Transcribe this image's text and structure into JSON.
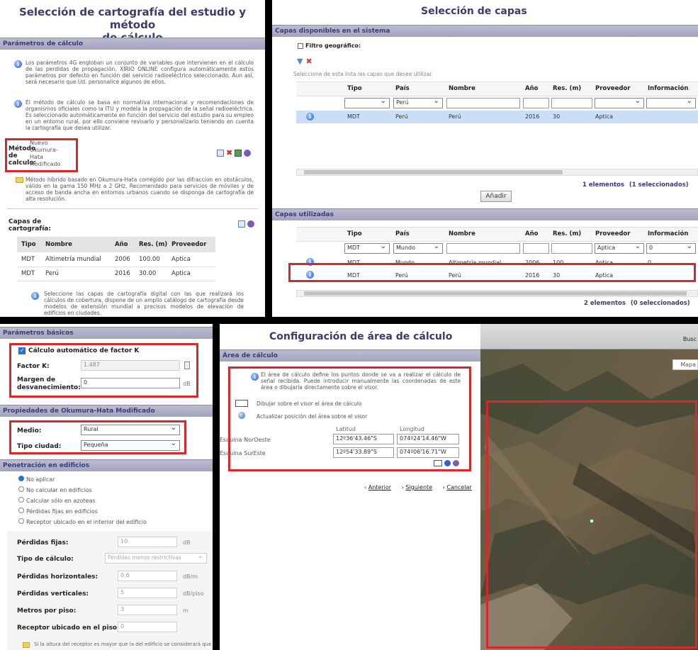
{
  "p1": {
    "title_l1": "Selección de cartografía del estudio y método",
    "title_l2": "de cálculo",
    "section": "Parámetros de cálculo",
    "info1": "Los parámetros 4G engloban un conjunto de variables que intervienen en el cálculo de las perdidas de propagación. XIRIO ONLINE configura automáticamente estos parámetros por defecto en función del servicio radioeléctrico seleccionado. Aun así, será necesario que Ud. personalice algunos de ellos.",
    "info2": "El método de cálculo se basa en normativa internacional y recomendaciones de organismos oficiales como la ITU y modela la propagación de la señal radioeléctrica. Es seleccionado automáticamente en función del servicio del estudio para su empleo en un entorno rural, por ello conviene revisarlo y personalizarlo teniendo en cuenta la cartografía que desea utilizar.",
    "metodo_l1": "Método",
    "metodo_l2": "de",
    "metodo_l3": "calculo:",
    "metodo_v1": "Nuevo",
    "metodo_v2": "Okumura-",
    "metodo_v3": "Hata",
    "metodo_v4": "Modificado",
    "desc": "Método híbrido basado en Okumura-Hata corregido por las difraccion en obstáculos, válido en la gama 150 MHz a 2 GHz. Recomendado para servicios de móviles y de acceso de banda ancha en entornos urbanos cuando se disponga de cartografía de alta resolución.",
    "capas_l1": "Capas de",
    "capas_l2": "cartografía:",
    "cols": [
      "Tipo",
      "Nombre",
      "Año",
      "Res. (m)",
      "Proveedor"
    ],
    "rows": [
      [
        "MDT",
        "Altimetría mundial",
        "2006",
        "100.00",
        "Aptica"
      ],
      [
        "MDT",
        "Perú",
        "2016",
        "30.00",
        "Aptica"
      ]
    ],
    "info3": "Seleccione las capas de cartografía digital con las que realizará los cálculos de cobertura, dispone de un amplio catálogo de cartografía desde modelos de extensión mundial a precisos modelos de elevación de edificios en ciudades."
  },
  "p2": {
    "title": "Selección de capas",
    "section1": "Capas disponibles en el sistema",
    "filtro": "Filtro geográfico:",
    "hint": "Seleccione de esta lista las capas que desee utilizar.",
    "cols": [
      "Tipo",
      "País",
      "Nombre",
      "Año",
      "Res. (m)",
      "Proveedor",
      "Información"
    ],
    "filter1_pais": "Perú",
    "row1": [
      "MDT",
      "Perú",
      "Perú",
      "2016",
      "30",
      "Aptica",
      ""
    ],
    "count1": "1 elementos",
    "sel1": "(1 seleccionados)",
    "add": "Añadir",
    "section2": "Capas utilizadas",
    "filter2_tipo": "MDT",
    "filter2_pais": "Mundo",
    "filter2_prov": "Aptica",
    "filter2_info": "0",
    "rows2": [
      [
        "MDT",
        "Mundo",
        "Altimetría mundial",
        "2006",
        "100",
        "Aptica",
        "0"
      ],
      [
        "MDT",
        "Perú",
        "Perú",
        "2016",
        "30",
        "Aptica",
        ""
      ]
    ],
    "count2": "2 elementos",
    "sel2": "(0 seleccionados)"
  },
  "p3": {
    "section1": "Parámetros básicos",
    "auto_k": "Cálculo automático de factor K",
    "factor_k_label": "Factor K:",
    "factor_k": "1.487",
    "margen_l1": "Margen de",
    "margen_l2": "desvanecimiento:",
    "margen": "0",
    "margen_unit": "dB",
    "section2": "Propiedades de Okumura-Hata Modificado",
    "medio_label": "Medio:",
    "medio": "Rural",
    "ciudad_label": "Tipo ciudad:",
    "ciudad": "Pequeña",
    "section3": "Penetración en edificios",
    "radios": [
      "No aplicar",
      "No calcular en edificios",
      "Calcular sólo en azoteas",
      "Pérdidas fijas en edificios",
      "Receptor ubicado en el interior del edificio"
    ],
    "fijas_label": "Pérdidas fijas:",
    "fijas": "10",
    "fijas_unit": "dB",
    "tipo_label": "Tipo de cálculo:",
    "tipo": "Pérdidas menos restrictivas",
    "horiz_label": "Pérdidas horizontales:",
    "horiz": "0.6",
    "horiz_unit": "dB/m",
    "vert_label": "Pérdidas verticales:",
    "vert": "5",
    "vert_unit": "dB/piso",
    "metros_label": "Metros por piso:",
    "metros": "3",
    "metros_unit": "m",
    "receptor_label": "Receptor ubicado en el piso:",
    "receptor": "0",
    "note": "Si la altura del receptor es mayor que la del edificio se considerará que el"
  },
  "p4": {
    "title": "Configuración de área de cálculo",
    "section": "Área de cálculo",
    "info": "El área de cálculo define los puntos donde se va a realizar el cálculo de señal recibida. Puede introducir manualmente las coordenadas de este área o dibujarla directamente sobre el visor.",
    "draw": "Dibujar sobre el visor el área de cálculo",
    "update": "Actualizar posición del área sobre el visor",
    "lat": "Latitud",
    "lon": "Longitud",
    "no_label": "Esquina NorOeste",
    "no_lat": "12º36'43.46\"S",
    "no_lon": "074º24'14.46\"W",
    "se_label": "Esquina SurEste",
    "se_lat": "12º54'33.89\"S",
    "se_lon": "074º06'16.71\"W",
    "prev": "Anterior",
    "next": "Siguiente",
    "cancel": "Cancelar"
  },
  "p5": {
    "search": "Busc",
    "map_btn": "Mapa"
  }
}
